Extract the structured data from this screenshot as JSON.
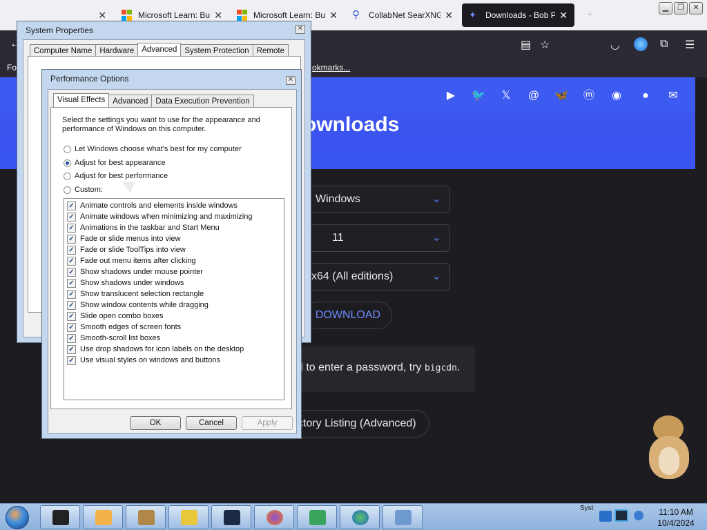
{
  "browser": {
    "tabs": [
      {
        "title": "",
        "active": false
      },
      {
        "title": "Microsoft Learn: Buil",
        "active": false
      },
      {
        "title": "Microsoft Learn: Buil",
        "active": false
      },
      {
        "title": "CollabNet SearXNG",
        "active": false
      },
      {
        "title": "Downloads - Bob Po",
        "active": true
      }
    ],
    "new_tab_label": "+",
    "bookmarks_left": "Fo",
    "bookmarks_right": "okmarks..."
  },
  "page": {
    "heading": "ownloads",
    "os_select": "Windows",
    "version_select": "11",
    "arch_select": "x64 (All editions)",
    "download_button": "DOWNLOAD",
    "notice_text": "d to enter a password, try ",
    "notice_code": "bigcdn",
    "notice_end": ".",
    "directory_button": "ctory Listing (Advanced)"
  },
  "system_properties": {
    "title": "System Properties",
    "tabs": [
      "Computer Name",
      "Hardware",
      "Advanced",
      "System Protection",
      "Remote"
    ],
    "selected_tab": "Advanced"
  },
  "performance_options": {
    "title": "Performance Options",
    "tabs": [
      "Visual Effects",
      "Advanced",
      "Data Execution Prevention"
    ],
    "selected_tab": "Visual Effects",
    "description": "Select the settings you want to use for the appearance and performance of Windows on this computer.",
    "radios": [
      {
        "label": "Let Windows choose what's best for my computer",
        "checked": false
      },
      {
        "label": "Adjust for best appearance",
        "checked": true
      },
      {
        "label": "Adjust for best performance",
        "checked": false
      },
      {
        "label": "Custom:",
        "checked": false
      }
    ],
    "effects": [
      {
        "label": "Animate controls and elements inside windows",
        "checked": true
      },
      {
        "label": "Animate windows when minimizing and maximizing",
        "checked": true
      },
      {
        "label": "Animations in the taskbar and Start Menu",
        "checked": true
      },
      {
        "label": "Fade or slide menus into view",
        "checked": true
      },
      {
        "label": "Fade or slide ToolTips into view",
        "checked": true
      },
      {
        "label": "Fade out menu items after clicking",
        "checked": true
      },
      {
        "label": "Show shadows under mouse pointer",
        "checked": true
      },
      {
        "label": "Show shadows under windows",
        "checked": true
      },
      {
        "label": "Show translucent selection rectangle",
        "checked": true
      },
      {
        "label": "Show window contents while dragging",
        "checked": true
      },
      {
        "label": "Slide open combo boxes",
        "checked": true
      },
      {
        "label": "Smooth edges of screen fonts",
        "checked": true
      },
      {
        "label": "Smooth-scroll list boxes",
        "checked": true
      },
      {
        "label": "Use drop shadows for icon labels on the desktop",
        "checked": true
      },
      {
        "label": "Use visual styles on windows and buttons",
        "checked": true
      }
    ],
    "ok_label": "OK",
    "cancel_label": "Cancel",
    "apply_label": "Apply"
  },
  "taskbar": {
    "time": "11:10 AM",
    "date": "10/4/2024",
    "tray_label": "Syst"
  },
  "colors": {
    "brand_blue": "#3d5af1",
    "page_bg": "#1c1c21",
    "window_frame": "#c3d7ee"
  }
}
